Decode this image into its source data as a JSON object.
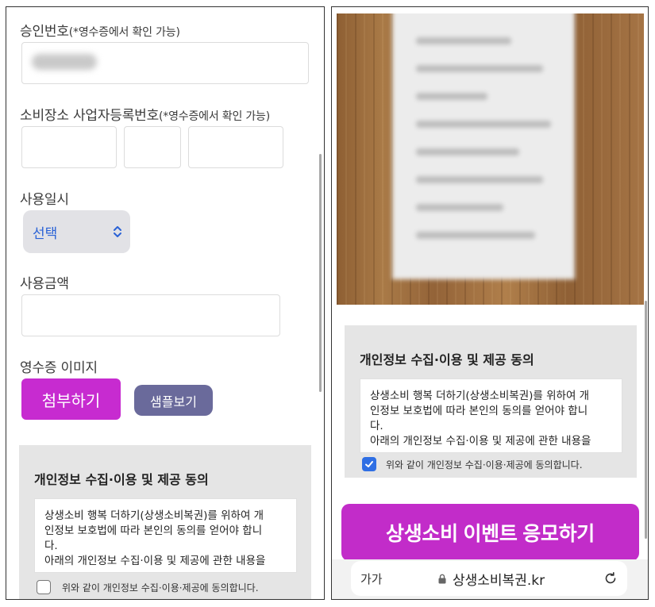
{
  "left": {
    "approval": {
      "label": "승인번호",
      "hint": "(*영수증에서 확인 가능)"
    },
    "business_reg": {
      "label": "소비장소 사업자등록번호",
      "hint": "(*영수증에서 확인 가능)"
    },
    "use_datetime": {
      "label": "사용일시",
      "select_value": "선택"
    },
    "amount": {
      "label": "사용금액"
    },
    "receipt_image": {
      "label": "영수증 이미지",
      "attach_button": "첨부하기",
      "sample_button": "샘플보기"
    },
    "consent": {
      "title": "개인정보 수집·이용 및 제공 동의",
      "text_lines": [
        "상생소비 행복 더하기(상생소비복권)를 위하여 개",
        "인정보 보호법에 따라 본인의 동의를 얻어야 합니",
        "다.",
        "아래의 개인정보 수집·이용 및 제공에 관한 내용을"
      ],
      "checkbox_label": "위와 같이 개인정보 수집·이용·제공에 동의합니다.",
      "checked": false
    }
  },
  "right": {
    "consent": {
      "title": "개인정보 수집·이용 및 제공 동의",
      "text_lines": [
        "상생소비 행복 더하기(상생소비복권)를 위하여 개",
        "인정보 보호법에 따라 본인의 동의를 얻어야 합니",
        "다.",
        "아래의 개인정보 수집·이용 및 제공에 관한 내용을"
      ],
      "checkbox_label": "위와 같이 개인정보 수집·이용·제공에 동의합니다.",
      "checked": true
    },
    "submit_button": "상생소비 이벤트 응모하기",
    "browser": {
      "text_size_button": "가가",
      "url": "상생소비복권.kr"
    }
  },
  "colors": {
    "primary": "#c72bd0",
    "sample": "#6a6a9b",
    "select_text": "#2a62d6",
    "check": "#2f6fe4"
  },
  "icons": [
    "chevron-updown-icon",
    "checkmark-icon",
    "lock-icon",
    "reload-icon"
  ]
}
